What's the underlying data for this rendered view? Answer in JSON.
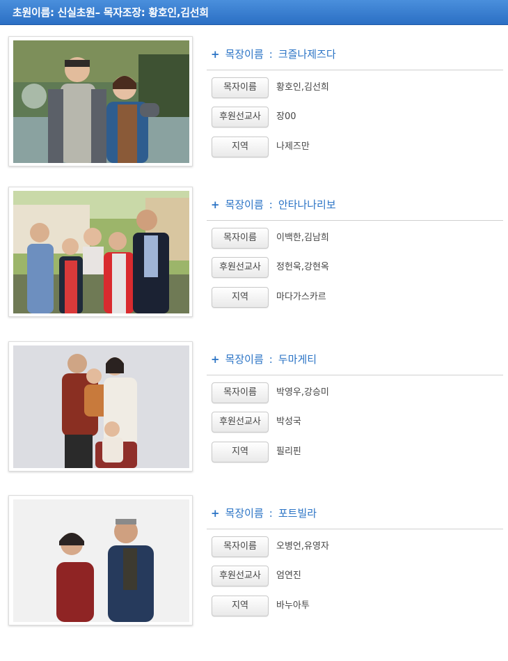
{
  "header": {
    "title": "초원이름: 신실초원– 목자조장: 황호인,김선희"
  },
  "colors": {
    "header": "#2b6fc4",
    "accent": "#2a73c5"
  },
  "title_prefix": "+",
  "title_label": "목장이름",
  "title_colon": ":",
  "field_labels": {
    "shepherd": "목자이름",
    "missionary": "후원선교사",
    "region": "지역"
  },
  "groups": [
    {
      "name": "크즐나제즈다",
      "shepherd": "황호인,김선희",
      "missionary": "장00",
      "region": "나제즈만"
    },
    {
      "name": "안타나나리보",
      "shepherd": "이백한,김남희",
      "missionary": "정헌욱,강현옥",
      "region": "마다가스카르"
    },
    {
      "name": "두마게티",
      "shepherd": "박영우,강승미",
      "missionary": "박성국",
      "region": "필리핀"
    },
    {
      "name": "포트빌라",
      "shepherd": "오병언,유영자",
      "missionary": "엄연진",
      "region": "바누아투"
    }
  ]
}
